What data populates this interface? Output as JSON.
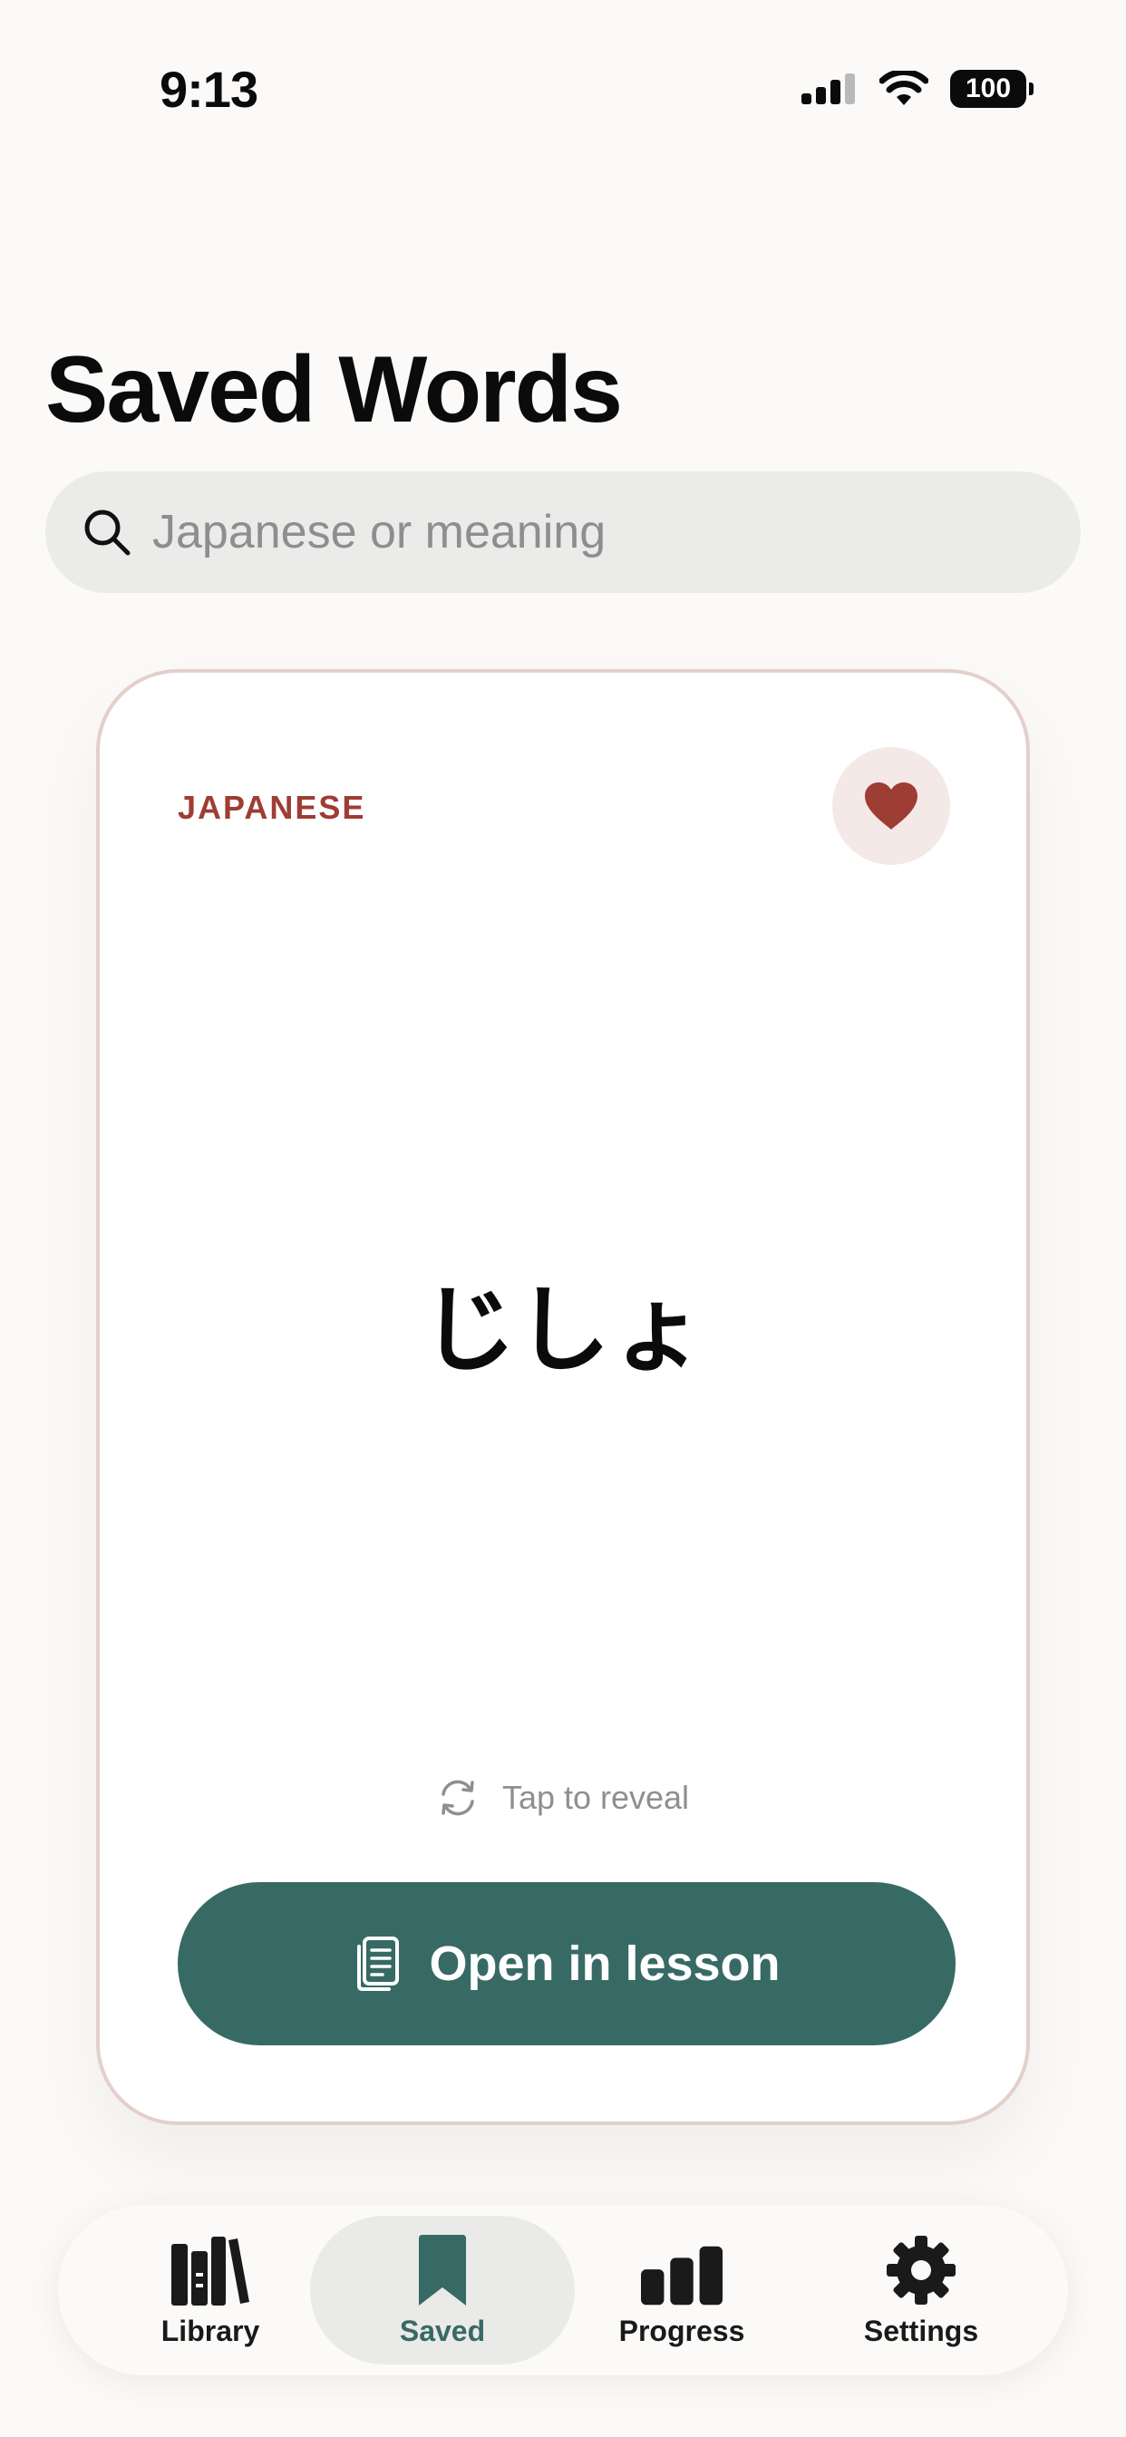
{
  "status_bar": {
    "time": "9:13",
    "battery": "100"
  },
  "page": {
    "title": "Saved Words"
  },
  "search": {
    "placeholder": "Japanese or meaning",
    "value": ""
  },
  "card": {
    "language_label": "JAPANESE",
    "word": "じしょ",
    "favorited": true,
    "reveal_hint": "Tap to reveal",
    "open_lesson_label": "Open in lesson"
  },
  "tabs": [
    {
      "label": "Library",
      "icon": "books-icon",
      "active": false
    },
    {
      "label": "Saved",
      "icon": "bookmark-icon",
      "active": true
    },
    {
      "label": "Progress",
      "icon": "bar-chart-icon",
      "active": false
    },
    {
      "label": "Settings",
      "icon": "gear-icon",
      "active": false
    }
  ],
  "colors": {
    "accent": "#386a65",
    "language_label": "#9e3d33",
    "heart": "#9e3d33",
    "background": "#fbfaf8"
  }
}
